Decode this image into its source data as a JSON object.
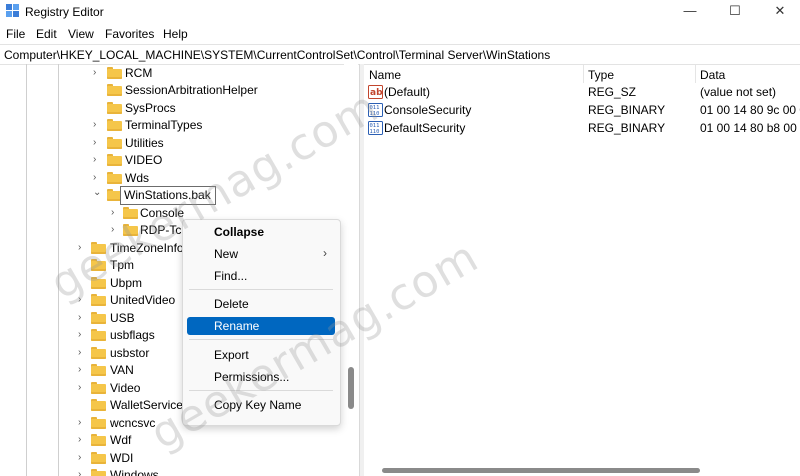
{
  "window": {
    "title": "Registry Editor",
    "controls": {
      "minimize": "—",
      "maximize": "☐",
      "close": "✕"
    }
  },
  "menu": [
    "File",
    "Edit",
    "View",
    "Favorites",
    "Help"
  ],
  "address": "Computer\\HKEY_LOCAL_MACHINE\\SYSTEM\\CurrentControlSet\\Control\\Terminal Server\\WinStations",
  "tree": {
    "rows": [
      {
        "label": "RCM",
        "expander": "›"
      },
      {
        "label": "SessionArbitrationHelper",
        "expander": ""
      },
      {
        "label": "SysProcs",
        "expander": ""
      },
      {
        "label": "TerminalTypes",
        "expander": "›"
      },
      {
        "label": "Utilities",
        "expander": "›"
      },
      {
        "label": "VIDEO",
        "expander": "›"
      },
      {
        "label": "Wds",
        "expander": "›"
      },
      {
        "label": "WinStations.bak",
        "expander": "⌄"
      },
      {
        "label": "Console",
        "expander": "›"
      },
      {
        "label": "RDP-Tcp",
        "expander": "›"
      },
      {
        "label": "TimeZoneInfor",
        "expander": "›"
      },
      {
        "label": "Tpm",
        "expander": ""
      },
      {
        "label": "Ubpm",
        "expander": ""
      },
      {
        "label": "UnitedVideo",
        "expander": "›"
      },
      {
        "label": "USB",
        "expander": "›"
      },
      {
        "label": "usbflags",
        "expander": "›"
      },
      {
        "label": "usbstor",
        "expander": "›"
      },
      {
        "label": "VAN",
        "expander": "›"
      },
      {
        "label": "Video",
        "expander": "›"
      },
      {
        "label": "WalletService",
        "expander": ""
      },
      {
        "label": "wcncsvc",
        "expander": "›"
      },
      {
        "label": "Wdf",
        "expander": "›"
      },
      {
        "label": "WDI",
        "expander": "›"
      },
      {
        "label": "Windows",
        "expander": "›"
      }
    ]
  },
  "values": {
    "columns": [
      "Name",
      "Type",
      "Data"
    ],
    "rows": [
      {
        "icon": "string-value-icon",
        "name": "(Default)",
        "type": "REG_SZ",
        "data": "(value not set)"
      },
      {
        "icon": "binary-value-icon",
        "name": "ConsoleSecurity",
        "type": "REG_BINARY",
        "data": "01 00 14 80 9c 00 0"
      },
      {
        "icon": "binary-value-icon",
        "name": "DefaultSecurity",
        "type": "REG_BINARY",
        "data": "01 00 14 80 b8 00 0"
      }
    ]
  },
  "context_menu": {
    "items": [
      {
        "label": "Collapse",
        "bold": true
      },
      {
        "label": "New",
        "submenu": "›"
      },
      {
        "label": "Find..."
      },
      {
        "label": "Delete"
      },
      {
        "label": "Rename",
        "highlighted": true
      },
      {
        "label": "Export"
      },
      {
        "label": "Permissions..."
      },
      {
        "label": "Copy Key Name"
      }
    ]
  },
  "watermark": "geekermag.com",
  "colors": {
    "highlight": "#0067c0",
    "folder": "#f5c64a"
  }
}
